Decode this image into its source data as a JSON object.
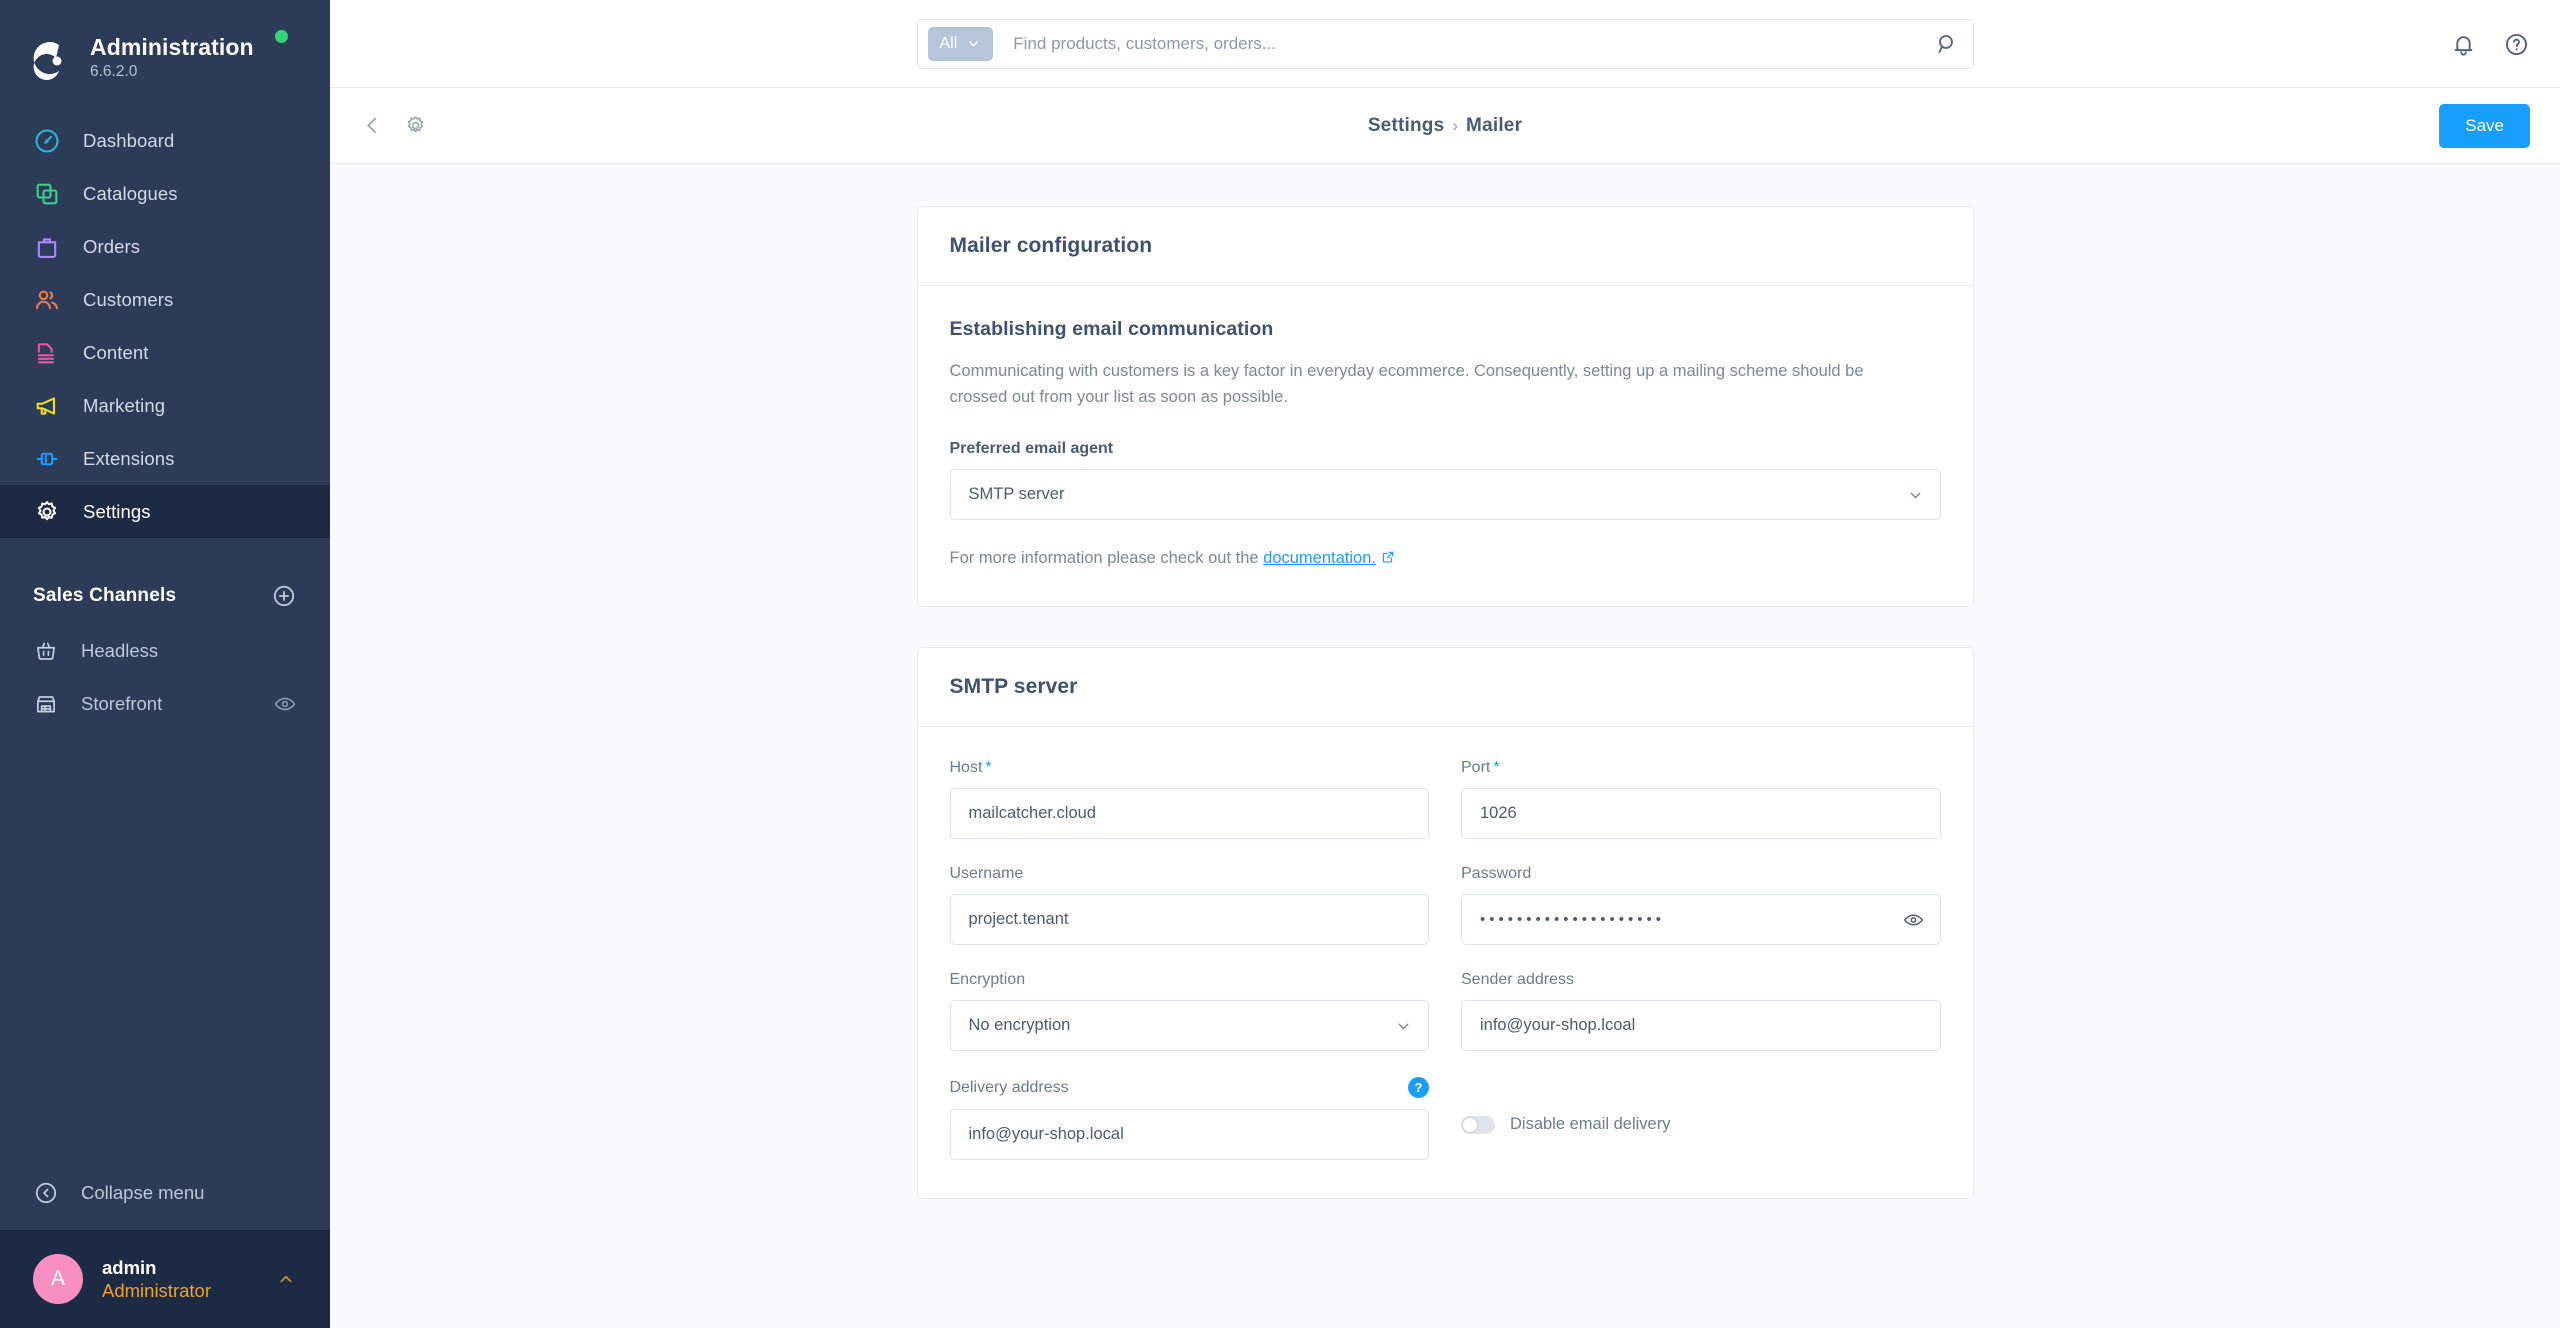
{
  "sidebar": {
    "logo_icon": "shopware-logo-icon",
    "title": "Administration",
    "version": "6.6.2.0",
    "status_dot": "online-status-dot",
    "status_color": "#37d279",
    "nav": [
      {
        "label": "Dashboard",
        "icon": "dashboard-icon",
        "color": "#2bb5d4",
        "active": false
      },
      {
        "label": "Catalogues",
        "icon": "catalogues-icon",
        "color": "#3ecf8e",
        "active": false
      },
      {
        "label": "Orders",
        "icon": "orders-icon",
        "color": "#a78bfa",
        "active": false
      },
      {
        "label": "Customers",
        "icon": "customers-icon",
        "color": "#ef7a45",
        "active": false
      },
      {
        "label": "Content",
        "icon": "content-icon",
        "color": "#e855a8",
        "active": false
      },
      {
        "label": "Marketing",
        "icon": "marketing-icon",
        "color": "#f0dd20",
        "active": false
      },
      {
        "label": "Extensions",
        "icon": "extensions-icon",
        "color": "#189eff",
        "active": false
      },
      {
        "label": "Settings",
        "icon": "settings-gear-icon",
        "color": "#ffffff",
        "active": true
      }
    ],
    "sales_channels": {
      "label": "Sales Channels",
      "add_icon": "circle-plus-icon",
      "items": [
        {
          "label": "Headless",
          "icon": "basket-icon",
          "visibility_icon": null
        },
        {
          "label": "Storefront",
          "icon": "storefront-icon",
          "visibility_icon": "eye-icon"
        }
      ]
    },
    "collapse": {
      "label": "Collapse menu",
      "icon": "circle-chevron-left-icon"
    },
    "user": {
      "avatar_initial": "A",
      "avatar_color": "#f88fc2",
      "name": "admin",
      "role": "Administrator",
      "role_color": "#e9a238",
      "caret_icon": "chevron-up-icon"
    }
  },
  "topbar": {
    "search": {
      "scope_label": "All",
      "scope_caret_icon": "chevron-down-icon",
      "placeholder": "Find products, customers, orders...",
      "value": "",
      "search_icon": "search-icon"
    },
    "notifications_icon": "bell-icon",
    "help_icon": "circle-question-icon"
  },
  "toolbar": {
    "back_icon": "chevron-left-icon",
    "settings_icon": "gear-icon",
    "breadcrumb": {
      "parent": "Settings",
      "separator": "›",
      "current": "Mailer"
    },
    "save_label": "Save",
    "save_color": "#189eff"
  },
  "mailer_card": {
    "title": "Mailer configuration",
    "section_title": "Establishing email communication",
    "section_desc": "Communicating with customers is a key factor in everyday ecommerce. Consequently, setting up a mailing scheme should be crossed out from your list as soon as possible.",
    "agent_label": "Preferred email agent",
    "agent_value": "SMTP server",
    "agent_caret_icon": "chevron-down-icon",
    "hint_prefix": "For more information please check out the ",
    "hint_link": "documentation.",
    "hint_link_icon": "external-link-icon"
  },
  "smtp_card": {
    "title": "SMTP server",
    "fields": {
      "host": {
        "label": "Host",
        "required": true,
        "required_mark": "*",
        "value": "mailcatcher.cloud"
      },
      "port": {
        "label": "Port",
        "required": true,
        "required_mark": "*",
        "value": "1026"
      },
      "username": {
        "label": "Username",
        "required": false,
        "value": "project.tenant"
      },
      "password": {
        "label": "Password",
        "required": false,
        "value": "••••••••••••••••••••",
        "toggle_icon": "eye-icon"
      },
      "encryption": {
        "label": "Encryption",
        "required": false,
        "value": "No encryption",
        "caret_icon": "chevron-down-icon"
      },
      "sender": {
        "label": "Sender address",
        "required": false,
        "value": "info@your-shop.lcoal"
      },
      "delivery": {
        "label": "Delivery address",
        "required": false,
        "value": "info@your-shop.local",
        "help_icon": "help-badge-icon",
        "help_mark": "?"
      }
    },
    "disable_delivery": {
      "label": "Disable email delivery",
      "enabled": false
    }
  }
}
